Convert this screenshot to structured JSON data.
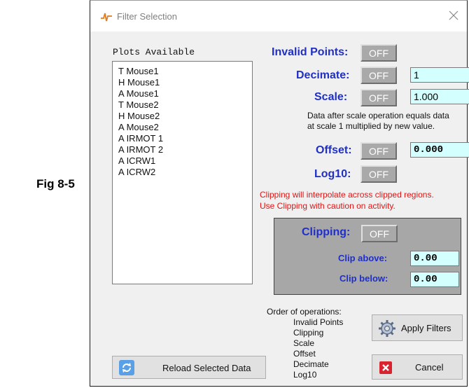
{
  "figure_label": "Fig 8-5",
  "window": {
    "title": "Filter Selection"
  },
  "plots": {
    "label": "Plots Available",
    "items": [
      "T Mouse1",
      "H Mouse1",
      "A Mouse1",
      "T Mouse2",
      "H Mouse2",
      "A Mouse2",
      "A IRMOT 1",
      "A IRMOT 2",
      "A ICRW1",
      "A ICRW2"
    ]
  },
  "invalid_points": {
    "label": "Invalid Points:",
    "toggle": "OFF"
  },
  "decimate": {
    "label": "Decimate:",
    "toggle": "OFF",
    "value": "1"
  },
  "scale": {
    "label": "Scale:",
    "toggle": "OFF",
    "value": "1.000",
    "note_line1": "Data after scale operation equals data",
    "note_line2": "at scale 1 multiplied by new value."
  },
  "offset": {
    "label": "Offset:",
    "toggle": "OFF",
    "value": "0.000"
  },
  "log10": {
    "label": "Log10:",
    "toggle": "OFF"
  },
  "clipping_warning": {
    "line1": "Clipping will interpolate across clipped regions.",
    "line2": "Use Clipping with caution on activity."
  },
  "clipping": {
    "label": "Clipping:",
    "toggle": "OFF",
    "clip_above_label": "Clip above:",
    "clip_above_value": "0.00",
    "clip_below_label": "Clip below:",
    "clip_below_value": "0.00"
  },
  "operations": {
    "title": "Order of operations:",
    "items": [
      "Invalid Points",
      "Clipping",
      "Scale",
      "Offset",
      "Decimate",
      "Log10"
    ]
  },
  "buttons": {
    "reload": "Reload Selected Data",
    "apply": "Apply Filters",
    "cancel": "Cancel"
  },
  "colors": {
    "label_blue": "#1f2fc8",
    "warning_red": "#e01414",
    "value_bg": "#d4ffff",
    "toggle_gray": "#a9a9a9"
  }
}
